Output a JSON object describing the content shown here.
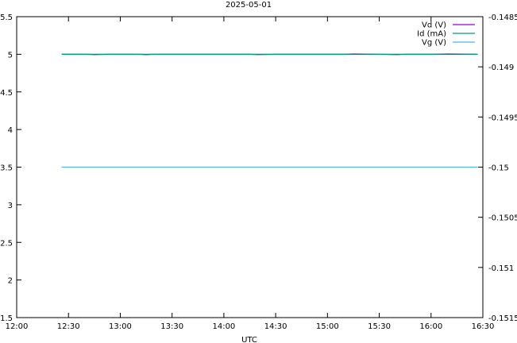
{
  "chart_data": {
    "type": "line",
    "title": "2025-05-01",
    "xlabel": "UTC",
    "ylabel": "",
    "y2label": "",
    "x_ticks": [
      "12:00",
      "12:30",
      "13:00",
      "13:30",
      "14:00",
      "14:30",
      "15:00",
      "15:30",
      "16:00",
      "16:30"
    ],
    "x_range": [
      "12:00",
      "16:30"
    ],
    "y_ticks": [
      "1.5",
      "2",
      "2.5",
      "3",
      "3.5",
      "4",
      "4.5",
      "5",
      "5.5"
    ],
    "ylim": [
      1.5,
      5.5
    ],
    "y2_ticks": [
      "-0.1515",
      "-0.151",
      "-0.1505",
      "-0.15",
      "-0.1495",
      "-0.149",
      "-0.1485"
    ],
    "y2lim": [
      -0.1515,
      -0.1485
    ],
    "grid": false,
    "legend_position": "top-right",
    "series": [
      {
        "name": "Vd (V)",
        "color": "#9400d3",
        "axis": "y",
        "x": [
          "12:26",
          "16:27"
        ],
        "values": [
          5.0,
          5.0
        ]
      },
      {
        "name": "Id (mA)",
        "color": "#009e73",
        "axis": "y",
        "x": [
          "12:26",
          "12:40",
          "12:45",
          "12:53",
          "13:00",
          "13:10",
          "13:15",
          "13:20",
          "13:30",
          "13:45",
          "14:00",
          "14:15",
          "14:20",
          "14:30",
          "14:45",
          "15:00",
          "15:10",
          "15:15",
          "15:30",
          "15:40",
          "15:45",
          "16:00",
          "16:10",
          "16:27"
        ],
        "values": [
          5.0,
          5.0,
          4.995,
          5.0,
          5.0,
          5.0,
          4.995,
          5.0,
          5.0,
          5.0,
          5.0,
          5.0,
          4.995,
          5.0,
          5.0,
          5.0,
          5.0,
          5.005,
          5.0,
          4.995,
          5.0,
          5.0,
          5.005,
          5.0
        ]
      },
      {
        "name": "Vg (V)",
        "color": "#56b4e9",
        "axis": "y2",
        "x": [
          "12:26",
          "16:27"
        ],
        "values": [
          -0.15,
          -0.15
        ]
      }
    ]
  }
}
